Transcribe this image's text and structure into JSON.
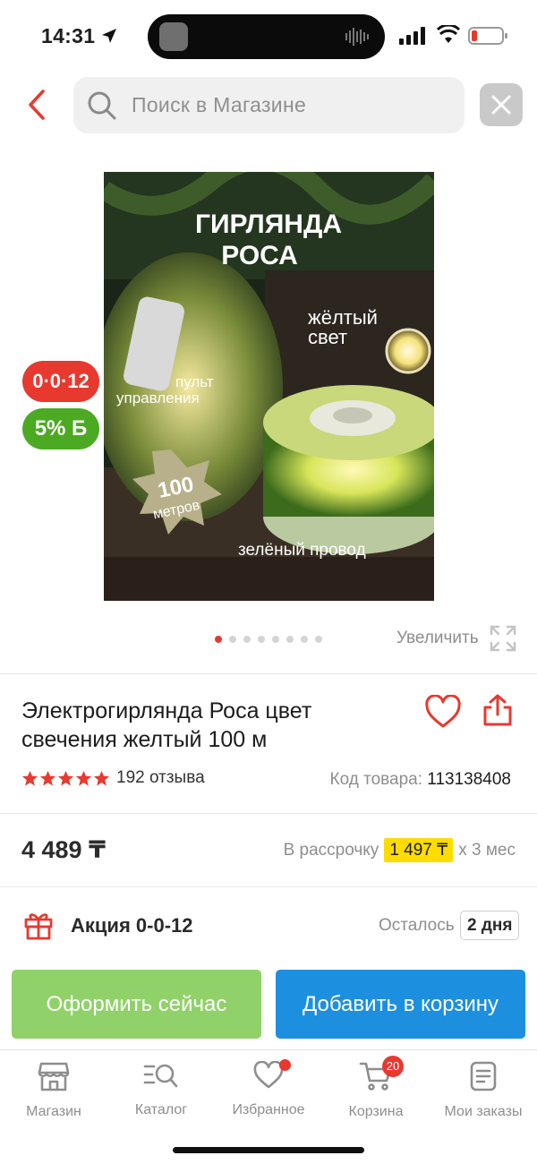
{
  "status_bar": {
    "time": "14:31"
  },
  "search": {
    "placeholder": "Поиск в Магазине"
  },
  "image_overlay": {
    "headline_1": "ГИРЛЯНДА",
    "headline_2": "РОСА",
    "color_1": "жёлтый",
    "color_2": "свет",
    "remote_1": "пульт",
    "remote_2": "управления",
    "length_1": "100",
    "length_2": "метров",
    "wire": "зелёный провод"
  },
  "badges": {
    "promo": "0·0·12",
    "bonus": "5%",
    "bonus_suffix": "Б"
  },
  "gallery": {
    "zoom_label": "Увеличить",
    "dots_total": 8,
    "active_index": 0
  },
  "product": {
    "title": "Электрогирлянда Роса цвет свечения желтый 100 м",
    "rating": 5,
    "reviews": "192 отзыва",
    "code_label": "Код товара:",
    "code": "113138408"
  },
  "pricing": {
    "price": "4 489 ₸",
    "installment_label": "В рассрочку",
    "installment_amount": "1 497 ₸",
    "installment_term": "х 3 мес"
  },
  "promo": {
    "label": "Акция 0-0-12",
    "remaining_label": "Осталось",
    "remaining_value": "2 дня"
  },
  "actions": {
    "buy_now": "Оформить сейчас",
    "add_to_cart": "Добавить в корзину"
  },
  "tabbar": {
    "items": [
      {
        "label": "Магазин",
        "icon": "store-icon"
      },
      {
        "label": "Каталог",
        "icon": "catalog-search-icon"
      },
      {
        "label": "Избранное",
        "icon": "heart-icon"
      },
      {
        "label": "Корзина",
        "icon": "cart-icon",
        "badge": "20"
      },
      {
        "label": "Мои заказы",
        "icon": "orders-icon"
      }
    ]
  },
  "colors": {
    "accent_red": "#e8392f",
    "buy_green": "#90d269",
    "cart_blue": "#1c90df",
    "badge_green": "#4caa22",
    "highlight_yellow": "#fedc00"
  }
}
